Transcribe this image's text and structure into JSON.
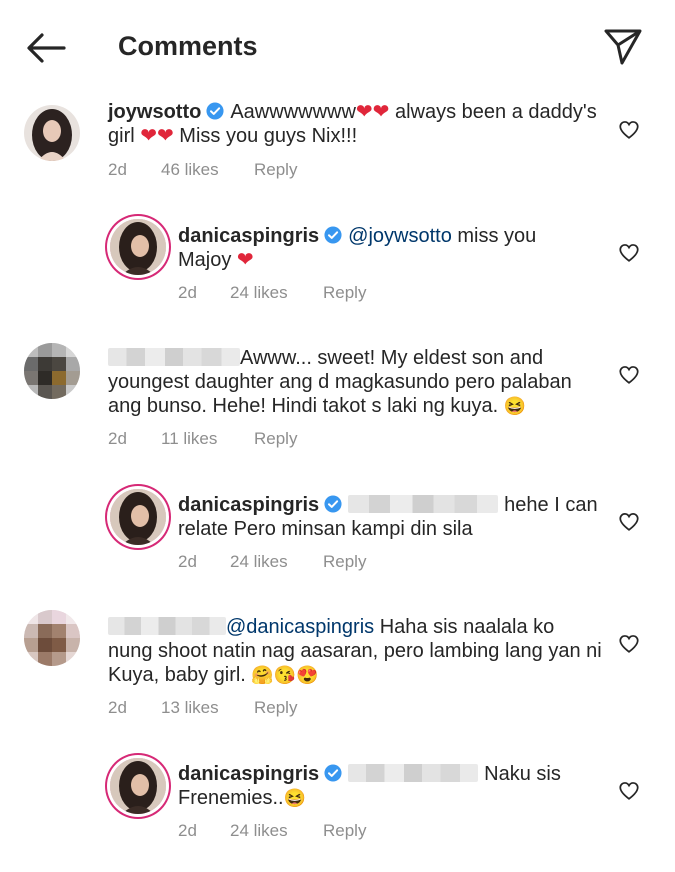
{
  "header": {
    "title": "Comments",
    "back_icon": "arrow-left-icon",
    "share_icon": "paper-plane-icon"
  },
  "colors": {
    "text": "#262626",
    "meta": "#8e8e8e",
    "mention": "#00376b",
    "verified": "#3897f0",
    "heart": "#ed4956",
    "story_ring": "#d62976"
  },
  "comments": [
    {
      "username": "joywsotto",
      "verified": true,
      "text_1": "Aawwwwwww",
      "text_hearts_1": "❤❤",
      "text_2": " always been a daddy's girl ",
      "text_hearts_2": "❤❤",
      "text_3": " Miss you guys Nix!!!",
      "time": "2d",
      "likes": "46 likes",
      "reply": "Reply"
    },
    {
      "username": "danicaspingris",
      "verified": true,
      "mention": "@joywsotto",
      "text_1": " miss you Majoy ",
      "text_hearts_1": "❤",
      "time": "2d",
      "likes": "24 likes",
      "reply": "Reply"
    },
    {
      "username": "",
      "text_1": "Awww... sweet! My eldest son and youngest daughter ang d magkasundo pero palaban ang bunso. Hehe! Hindi takot s laki ng kuya. ",
      "emoji": "😆",
      "time": "2d",
      "likes": "11 likes",
      "reply": "Reply"
    },
    {
      "username": "danicaspingris",
      "verified": true,
      "text_1": "hehe I can relate Pero minsan kampi din sila",
      "time": "2d",
      "likes": "24 likes",
      "reply": "Reply"
    },
    {
      "username": "",
      "mention": "@danicaspingris",
      "text_1": " Haha sis naalala ko nung shoot natin nag aasaran, pero lambing lang yan ni Kuya, baby girl. ",
      "emoji": "🤗😘😍",
      "time": "2d",
      "likes": "13 likes",
      "reply": "Reply"
    },
    {
      "username": "danicaspingris",
      "verified": true,
      "text_1": "Naku sis Frenemies..",
      "emoji": "😆",
      "time": "2d",
      "likes": "24 likes",
      "reply": "Reply"
    }
  ]
}
